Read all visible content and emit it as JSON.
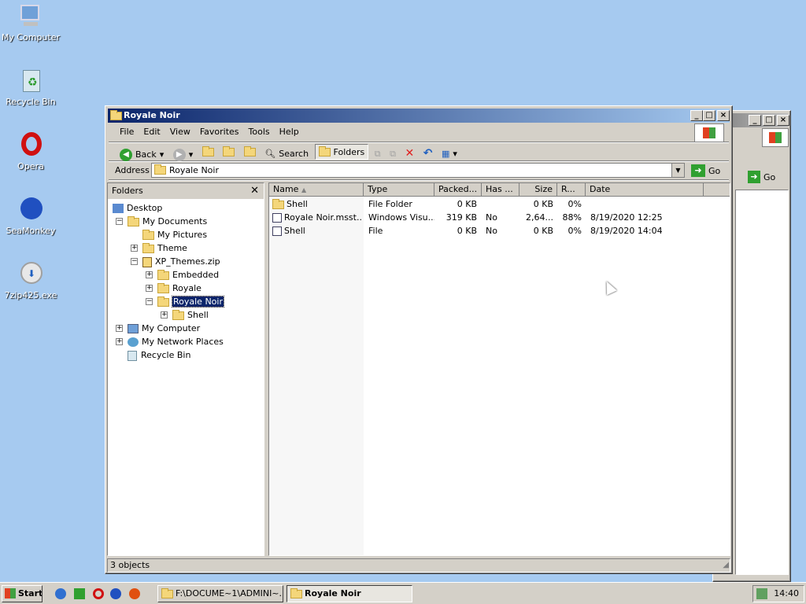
{
  "desktop": {
    "icons": [
      "My Computer",
      "Recycle Bin",
      "Opera",
      "SeaMonkey",
      "7zip425.exe"
    ]
  },
  "window": {
    "title": "Royale Noir",
    "menu": [
      "File",
      "Edit",
      "View",
      "Favorites",
      "Tools",
      "Help"
    ],
    "toolbar": {
      "back": "Back",
      "search": "Search",
      "folders": "Folders"
    },
    "address": {
      "label": "Address",
      "value": "Royale Noir",
      "go": "Go"
    },
    "folders_pane": {
      "title": "Folders",
      "tree": [
        "Desktop",
        "My Documents",
        "My Pictures",
        "Theme",
        "XP_Themes.zip",
        "Embedded",
        "Royale",
        "Royale Noir",
        "Shell",
        "My Computer",
        "My Network Places",
        "Recycle Bin"
      ]
    },
    "columns": [
      "Name",
      "Type",
      "Packed...",
      "Has ...",
      "Size",
      "R...",
      "Date"
    ],
    "files": [
      {
        "name": "Shell",
        "type": "File Folder",
        "packed": "0 KB",
        "has": "",
        "size": "0 KB",
        "ratio": "0%",
        "date": ""
      },
      {
        "name": "Royale Noir.msst...",
        "type": "Windows Visu...",
        "packed": "319 KB",
        "has": "No",
        "size": "2,64...",
        "ratio": "88%",
        "date": "8/19/2020 12:25"
      },
      {
        "name": "Shell",
        "type": "File",
        "packed": "0 KB",
        "has": "No",
        "size": "0 KB",
        "ratio": "0%",
        "date": "8/19/2020 14:04"
      }
    ],
    "status": "3 objects"
  },
  "back_window": {
    "go": "Go"
  },
  "taskbar": {
    "start": "Start",
    "tasks": [
      "F:\\DOCUME~1\\ADMINI~...",
      "Royale Noir"
    ],
    "clock": "14:40"
  }
}
